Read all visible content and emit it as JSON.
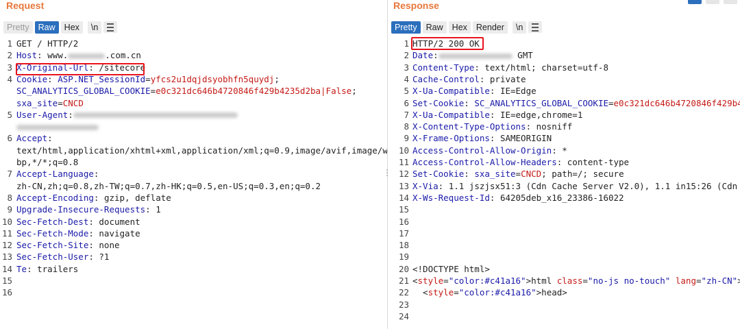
{
  "request": {
    "title": "Request",
    "tabs": [
      "Pretty",
      "Raw",
      "Hex",
      "\\n"
    ],
    "active_tab": "Raw",
    "lines": [
      {
        "n": "1",
        "segs": [
          [
            "GET / HTTP/2",
            "t"
          ]
        ]
      },
      {
        "n": "2",
        "segs": [
          [
            "Host",
            "k"
          ],
          [
            ": www.",
            "t"
          ],
          [
            "",
            "blur90"
          ],
          [
            ".com.cn",
            "t"
          ]
        ]
      },
      {
        "n": "3",
        "segs": [
          [
            "X-Original-Url",
            "k"
          ],
          [
            ": /sitecore",
            "t"
          ]
        ]
      },
      {
        "n": "4",
        "segs": [
          [
            "Cookie",
            "k"
          ],
          [
            ": ",
            "t"
          ],
          [
            "ASP.NET_SessionId",
            "k"
          ],
          [
            "=",
            "t"
          ],
          [
            "yfcs2u1dqjdsyobhfn5quydj",
            "v"
          ],
          [
            ";",
            "t"
          ]
        ]
      },
      {
        "n": "",
        "segs": [
          [
            "SC_ANALYTICS_GLOBAL_COOKIE",
            "k"
          ],
          [
            "=",
            "t"
          ],
          [
            "e0c321dc646b4720846f429b4235d2ba|False",
            "v"
          ],
          [
            ";",
            "t"
          ]
        ]
      },
      {
        "n": "",
        "segs": [
          [
            "sxa_site",
            "k"
          ],
          [
            "=",
            "t"
          ],
          [
            "CNCD",
            "v"
          ]
        ]
      },
      {
        "n": "5",
        "segs": [
          [
            "User-Agent",
            "k"
          ],
          [
            ":",
            "t"
          ],
          [
            "",
            "blur400"
          ]
        ]
      },
      {
        "n": "",
        "segs": [
          [
            "",
            "blur200"
          ]
        ]
      },
      {
        "n": "6",
        "segs": [
          [
            "Accept",
            "k"
          ],
          [
            ":",
            "t"
          ]
        ]
      },
      {
        "n": "",
        "segs": [
          [
            "text/html,application/xhtml+xml,application/xml;q=0.9,image/avif,image/we",
            "t"
          ]
        ]
      },
      {
        "n": "",
        "segs": [
          [
            "bp,*/*;q=0.8",
            "t"
          ]
        ]
      },
      {
        "n": "7",
        "segs": [
          [
            "Accept-Language",
            "k"
          ],
          [
            ":",
            "t"
          ]
        ]
      },
      {
        "n": "",
        "segs": [
          [
            "zh-CN,zh;q=0.8,zh-TW;q=0.7,zh-HK;q=0.5,en-US;q=0.3,en;q=0.2",
            "t"
          ]
        ]
      },
      {
        "n": "8",
        "segs": [
          [
            "Accept-Encoding",
            "k"
          ],
          [
            ": gzip, deflate",
            "t"
          ]
        ]
      },
      {
        "n": "9",
        "segs": [
          [
            "Upgrade-Insecure-Requests",
            "k"
          ],
          [
            ": 1",
            "t"
          ]
        ]
      },
      {
        "n": "10",
        "segs": [
          [
            "Sec-Fetch-Dest",
            "k"
          ],
          [
            ": document",
            "t"
          ]
        ]
      },
      {
        "n": "11",
        "segs": [
          [
            "Sec-Fetch-Mode",
            "k"
          ],
          [
            ": navigate",
            "t"
          ]
        ]
      },
      {
        "n": "12",
        "segs": [
          [
            "Sec-Fetch-Site",
            "k"
          ],
          [
            ": none",
            "t"
          ]
        ]
      },
      {
        "n": "13",
        "segs": [
          [
            "Sec-Fetch-User",
            "k"
          ],
          [
            ": ?1",
            "t"
          ]
        ]
      },
      {
        "n": "14",
        "segs": [
          [
            "Te",
            "k"
          ],
          [
            ": trailers",
            "t"
          ]
        ]
      },
      {
        "n": "15",
        "segs": []
      },
      {
        "n": "16",
        "segs": []
      }
    ]
  },
  "response": {
    "title": "Response",
    "tabs": [
      "Pretty",
      "Raw",
      "Hex",
      "Render",
      "\\n"
    ],
    "active_tab": "Pretty",
    "lines": [
      {
        "n": "1",
        "segs": [
          [
            "HTTP/2 200 OK",
            "t"
          ]
        ]
      },
      {
        "n": "2",
        "segs": [
          [
            "Date",
            "k"
          ],
          [
            ":",
            "t"
          ],
          [
            "",
            "blur180"
          ],
          [
            " GMT",
            "t"
          ]
        ]
      },
      {
        "n": "3",
        "segs": [
          [
            "Content-Type",
            "k"
          ],
          [
            ": text/html; charset=utf-8",
            "t"
          ]
        ]
      },
      {
        "n": "4",
        "segs": [
          [
            "Cache-Control",
            "k"
          ],
          [
            ": private",
            "t"
          ]
        ]
      },
      {
        "n": "5",
        "segs": [
          [
            "X-Ua-Compatible",
            "k"
          ],
          [
            ": IE=Edge",
            "t"
          ]
        ]
      },
      {
        "n": "6",
        "segs": [
          [
            "Set-Cookie",
            "k"
          ],
          [
            ": ",
            "t"
          ],
          [
            "SC_ANALYTICS_GLOBAL_COOKIE",
            "k"
          ],
          [
            "=",
            "t"
          ],
          [
            "e0c321dc646b4720846f429b4",
            "v"
          ]
        ]
      },
      {
        "n": "7",
        "segs": [
          [
            "X-Ua-Compatible",
            "k"
          ],
          [
            ": IE=edge,chrome=1",
            "t"
          ]
        ]
      },
      {
        "n": "8",
        "segs": [
          [
            "X-Content-Type-Options",
            "k"
          ],
          [
            ": nosniff",
            "t"
          ]
        ]
      },
      {
        "n": "9",
        "segs": [
          [
            "X-Frame-Options",
            "k"
          ],
          [
            ": SAMEORIGIN",
            "t"
          ]
        ]
      },
      {
        "n": "10",
        "segs": [
          [
            "Access-Control-Allow-Origin",
            "k"
          ],
          [
            ": *",
            "t"
          ]
        ]
      },
      {
        "n": "11",
        "segs": [
          [
            "Access-Control-Allow-Headers",
            "k"
          ],
          [
            ": content-type",
            "t"
          ]
        ]
      },
      {
        "n": "12",
        "segs": [
          [
            "Set-Cookie",
            "k"
          ],
          [
            ": ",
            "t"
          ],
          [
            "sxa_site",
            "k"
          ],
          [
            "=",
            "t"
          ],
          [
            "CNCD",
            "v"
          ],
          [
            "; path=/; secure",
            "t"
          ]
        ]
      },
      {
        "n": "13",
        "segs": [
          [
            "X-Via",
            "k"
          ],
          [
            ": 1.1 jszjsx51:3 (Cdn Cache Server V2.0), 1.1 in15:26 (Cdn C",
            "t"
          ]
        ]
      },
      {
        "n": "14",
        "segs": [
          [
            "X-Ws-Request-Id",
            "k"
          ],
          [
            ": 64205deb_x16_23386-16022",
            "t"
          ]
        ]
      },
      {
        "n": "15",
        "segs": []
      },
      {
        "n": "16",
        "segs": []
      },
      {
        "n": "17",
        "segs": []
      },
      {
        "n": "18",
        "segs": []
      },
      {
        "n": "19",
        "segs": []
      },
      {
        "n": "20",
        "segs": [
          [
            "<!DOCTYPE html>",
            "t"
          ]
        ]
      },
      {
        "n": "21",
        "segs": [
          [
            "<html class=\"no-js no-touch\" lang=\"zh-CN\">",
            "html"
          ]
        ]
      },
      {
        "n": "22",
        "segs": [
          [
            "  <head>",
            "html"
          ]
        ]
      },
      {
        "n": "23",
        "segs": []
      },
      {
        "n": "24",
        "segs": []
      }
    ]
  },
  "colors": {
    "accent": "#2b6fbd",
    "title": "#e8773a",
    "key": "#1a1aa8",
    "value": "#c41a16",
    "highlight": "#e8141c"
  }
}
